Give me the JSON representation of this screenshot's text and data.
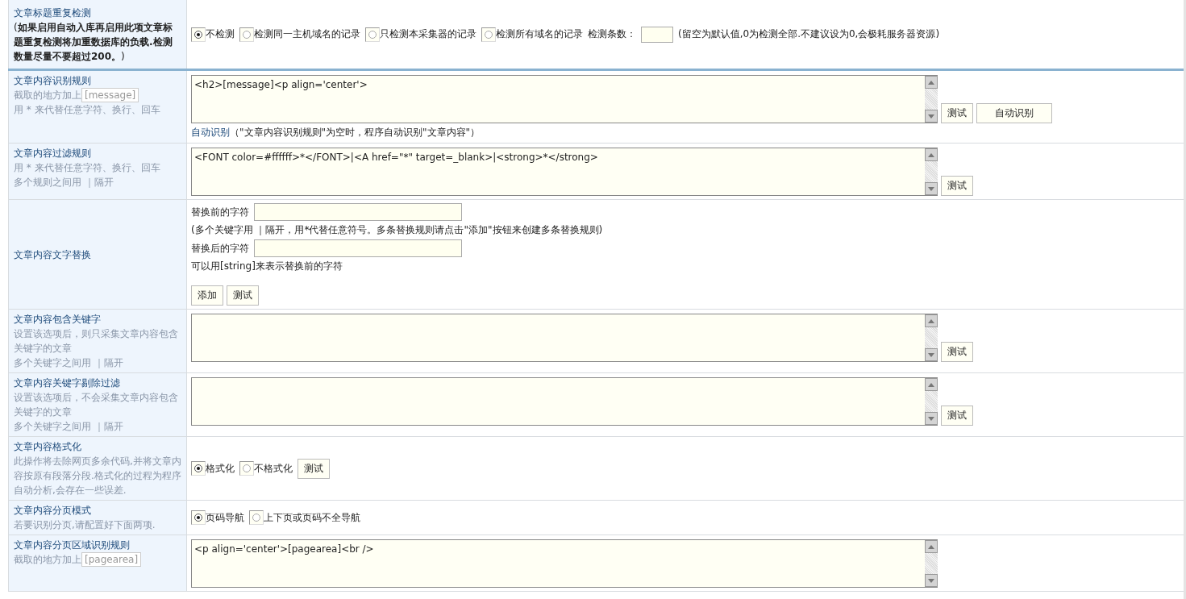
{
  "rows": [
    {
      "kind": "radios",
      "label": "文章标题重复检测",
      "warning": "(**如果启用自动入库再启用此项文章标题重复检测将加重数据库的负载.检测数量尽量不要超过200。**)",
      "options": [
        {
          "label": "不检测",
          "selected": true
        },
        {
          "label": "检测同一主机域名的记录",
          "selected": false
        },
        {
          "label": "只检测本采集器的记录",
          "selected": false
        },
        {
          "label": "检测所有域名的记录",
          "selected": false
        }
      ],
      "count_label": "检测条数：",
      "count_note": "(留空为默认值,0为检测全部.不建议设为0,会极耗服务器资源)"
    },
    {
      "kind": "textarea",
      "label": "文章内容识别规则",
      "notes": [
        {
          "text": "截取的地方加上",
          "tag": "[message]"
        },
        {
          "text": "用 * 来代替任意字符、换行、回车"
        }
      ],
      "value": "<h2>[message]<p align='center'>",
      "buttons": [
        "测试",
        "自动识别"
      ],
      "hint_link": "自动识别",
      "hint": "（\"文章内容识别规则\"为空时，程序自动识别\"文章内容\"）"
    },
    {
      "kind": "textarea",
      "label": "文章内容过滤规则",
      "notes": [
        {
          "text": "用 * 来代替任意字符、换行、回车"
        },
        {
          "text": "多个规则之间用 ｜隔开"
        }
      ],
      "value": "<FONT color=#ffffff>*</FONT>|<A href=\"*\" target=_blank>|<strong>*</strong>",
      "buttons": [
        "测试"
      ]
    },
    {
      "kind": "replace",
      "label": "文章内容文字替换",
      "before_label": "替换前的字符",
      "before_note": "(多个关键字用 ｜隔开，用*代替任意符号。多条替换规则请点击\"添加\"按钮来创建多条替换规则)",
      "after_label": "替换后的字符",
      "after_note": "可以用[string]来表示替换前的字符",
      "buttons": [
        "添加",
        "测试"
      ]
    },
    {
      "kind": "textarea",
      "label": "文章内容包含关键字",
      "notes": [
        {
          "text": "设置该选项后，则只采集文章内容包含关键字的文章"
        },
        {
          "text": "多个关键字之间用 ｜隔开"
        }
      ],
      "buttons": [
        "测试"
      ]
    },
    {
      "kind": "textarea",
      "label": "文章内容关键字剔除过滤",
      "notes": [
        {
          "text": "设置该选项后，不会采集文章内容包含关键字的文章"
        },
        {
          "text": "多个关键字之间用 ｜隔开"
        }
      ],
      "buttons": [
        "测试"
      ]
    },
    {
      "kind": "radios",
      "label": "文章内容格式化",
      "notes": [
        {
          "text": "此操作将去除网页多余代码,并将文章内容按原有段落分段.格式化的过程为程序自动分析,会存在一些误差."
        }
      ],
      "options": [
        {
          "label": "格式化",
          "selected": true
        },
        {
          "label": "不格式化",
          "selected": false
        }
      ],
      "buttons": [
        "测试"
      ]
    },
    {
      "kind": "radios",
      "label": "文章内容分页模式",
      "notes": [
        {
          "text": "若要识别分页,请配置好下面两项."
        }
      ],
      "options": [
        {
          "label": "页码导航",
          "selected": true
        },
        {
          "label": "上下页或页码不全导航",
          "selected": false
        }
      ]
    },
    {
      "kind": "textarea",
      "label": "文章内容分页区域识别规则",
      "notes": [
        {
          "text": "截取的地方加上",
          "tag": "[pagearea]"
        }
      ],
      "value": "<p align='center'>[pagearea]<br />"
    }
  ]
}
